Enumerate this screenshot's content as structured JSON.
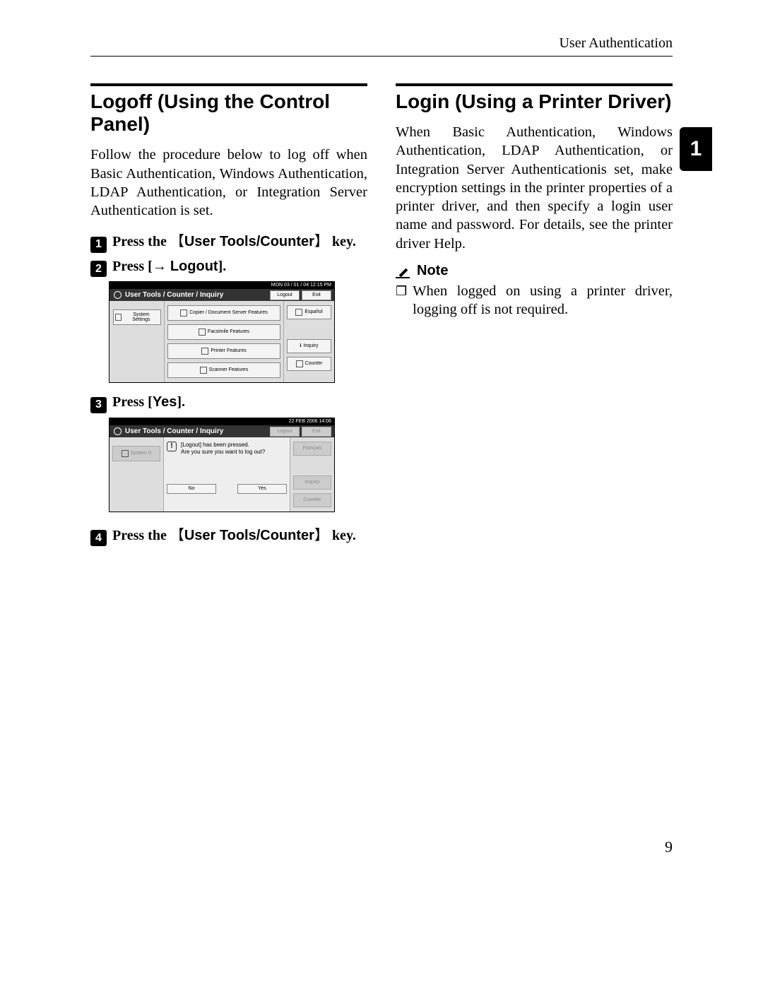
{
  "header": {
    "section": "User Authentication"
  },
  "chapter_tab": "1",
  "page_number": "9",
  "left": {
    "title": "Logoff (Using the Control Panel)",
    "intro": "Follow the procedure below to log off when Basic Authentication, Windows Authentication, LDAP Authentication, or Integration Server Authentication is set.",
    "step1": {
      "pre": "Press the ",
      "key": "User Tools/Counter",
      "post": " key."
    },
    "step2": {
      "pre": "Press [",
      "arrow": "→ ",
      "key": "Logout",
      "post": "]."
    },
    "step3": {
      "pre": "Press [",
      "key": "Yes",
      "post": "]."
    },
    "step4": {
      "pre": "Press the ",
      "key": "User Tools/Counter",
      "post": " key."
    },
    "screenshot1": {
      "topstrip": "MON   03 / 01 / 04   12:15 PM",
      "title": "User Tools / Counter / Inquiry",
      "logout": "Logout",
      "exit": "Exit",
      "system_settings": "System Settings",
      "copier_features": "Copier / Document Server Features",
      "fax_features": "Facsimile Features",
      "printer_features": "Printer Features",
      "scanner_features": "Scanner Features",
      "espanol": "Español",
      "inquiry": "Inquiry",
      "counter": "Counter"
    },
    "screenshot2": {
      "topstrip": "22  FEB   2006  14:06",
      "title": "User Tools / Counter / Inquiry",
      "logout": "Logout",
      "exit": "Exit",
      "system_s": "System S",
      "msg1": "[Logout] has been pressed.",
      "msg2": "Are you sure you want to log out?",
      "no": "No",
      "yes": "Yes",
      "francais": "Français",
      "inquiry": "Inquiry",
      "counter": "Counter"
    }
  },
  "right": {
    "title": "Login (Using a Printer Driver)",
    "body": "When Basic Authentication, Windows Authentication, LDAP Authentication, or Integration Server Authenticationis set, make encryption settings in the printer properties of a printer driver, and then specify a login user name and password. For details, see the printer driver Help.",
    "note_label": "Note",
    "note_item": "When logged on using a printer driver, logging off is not required."
  }
}
